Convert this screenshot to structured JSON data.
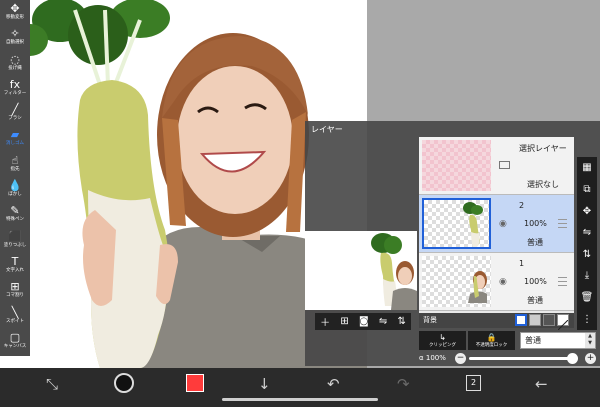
{
  "toolbar": {
    "tools": [
      {
        "name": "move",
        "label": "移動変形",
        "icon": "✥",
        "active": false
      },
      {
        "name": "auto-select",
        "label": "自動選択",
        "icon": "✧",
        "active": false
      },
      {
        "name": "lasso",
        "label": "投げ縄",
        "icon": "◌",
        "active": false
      },
      {
        "name": "filter",
        "label": "フィルター",
        "icon": "fx",
        "active": false
      },
      {
        "name": "brush",
        "label": "ブラシ",
        "icon": "╱",
        "active": false
      },
      {
        "name": "eraser",
        "label": "消しゴム",
        "icon": "▰",
        "active": true
      },
      {
        "name": "smudge",
        "label": "指先",
        "icon": "☝",
        "active": false
      },
      {
        "name": "blur",
        "label": "ぼかし",
        "icon": "💧",
        "active": false
      },
      {
        "name": "special-pen",
        "label": "特殊ペン",
        "icon": "✎",
        "active": false
      },
      {
        "name": "fill",
        "label": "塗りつぶし",
        "icon": "⬛",
        "active": false
      },
      {
        "name": "text",
        "label": "文字入れ",
        "icon": "T",
        "active": false
      },
      {
        "name": "frame-divider",
        "label": "コマ割り",
        "icon": "⊞",
        "active": false
      },
      {
        "name": "eyedropper",
        "label": "スポイト",
        "icon": "╲",
        "active": false
      },
      {
        "name": "canvas",
        "label": "キャンバス",
        "icon": "▢",
        "active": false
      }
    ]
  },
  "layer_panel": {
    "title": "レイヤー",
    "selection_layer": {
      "name": "選択レイヤー",
      "status": "選択なし"
    },
    "layers": [
      {
        "number": "2",
        "opacity": "100%",
        "blend": "普通",
        "selected": true
      },
      {
        "number": "1",
        "opacity": "100%",
        "blend": "普通",
        "selected": false
      }
    ],
    "background_label": "背景",
    "clipping_label": "クリッピング",
    "lock_label": "不透明度ロック",
    "blend_mode": "普通",
    "alpha_label": "α",
    "alpha_value": "100%",
    "alpha_fraction": 1.0
  },
  "bottom_bar": {
    "layer_count": "2"
  },
  "colors": {
    "accent": "#3d8cff",
    "current_color": "#ff3b3b",
    "toolbar_bg": "#4a4a4a",
    "bottom_bg": "#2b2b2b"
  }
}
